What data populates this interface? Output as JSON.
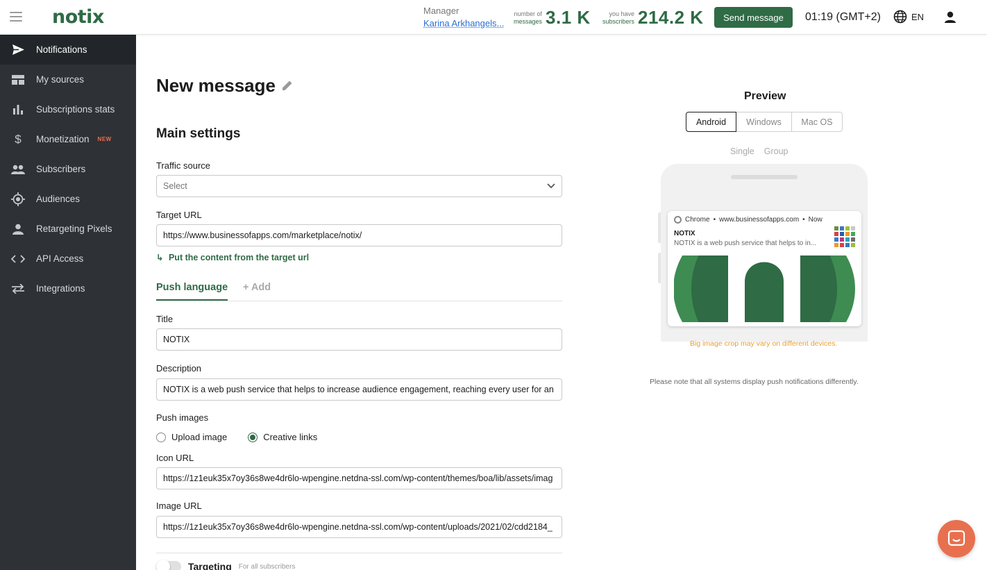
{
  "app": {
    "logo": "notix"
  },
  "header": {
    "manager_label": "Manager",
    "manager_name": "Karina Arkhangels...",
    "messages_small_1": "number of",
    "messages_small_2": "messages",
    "messages_value": "3.1 K",
    "subscribers_small_1": "you have",
    "subscribers_small_2": "subscribers",
    "subscribers_value": "214.2 K",
    "send_button": "Send message",
    "time": "01:19 (GMT+2)",
    "language": "EN"
  },
  "sidebar": {
    "items": [
      {
        "label": "Notifications",
        "icon": "send-icon",
        "active": true
      },
      {
        "label": "My sources",
        "icon": "sources-icon"
      },
      {
        "label": "Subscriptions stats",
        "icon": "bar-chart-icon"
      },
      {
        "label": "Monetization",
        "icon": "dollar-icon",
        "badge": "NEW"
      },
      {
        "label": "Subscribers",
        "icon": "people-icon"
      },
      {
        "label": "Audiences",
        "icon": "target-icon"
      },
      {
        "label": "Retargeting Pixels",
        "icon": "person-icon"
      },
      {
        "label": "API Access",
        "icon": "code-icon"
      },
      {
        "label": "Integrations",
        "icon": "swap-icon"
      }
    ]
  },
  "main": {
    "title": "New message",
    "section_title": "Main settings",
    "traffic_source": {
      "label": "Traffic source",
      "placeholder": "Select"
    },
    "target_url": {
      "label": "Target URL",
      "value": "https://www.businessofapps.com/marketplace/notix/"
    },
    "put_content_link": "Put the content from the target url",
    "tabs": {
      "active": "Push language",
      "add": "+ Add"
    },
    "title_field": {
      "label": "Title",
      "value": "NOTIX"
    },
    "description_field": {
      "label": "Description",
      "value": "NOTIX is a web push service that helps to increase audience engagement, reaching every user for an"
    },
    "push_images": {
      "label": "Push images",
      "options": [
        {
          "label": "Upload image",
          "selected": false
        },
        {
          "label": "Creative links",
          "selected": true
        }
      ]
    },
    "icon_url": {
      "label": "Icon URL",
      "value": "https://1z1euk35x7oy36s8we4dr6lo-wpengine.netdna-ssl.com/wp-content/themes/boa/lib/assets/imag"
    },
    "image_url": {
      "label": "Image URL",
      "value": "https://1z1euk35x7oy36s8we4dr6lo-wpengine.netdna-ssl.com/wp-content/uploads/2021/02/cdd2184_"
    },
    "targeting": {
      "label": "Targeting",
      "sub": "For all subscribers"
    }
  },
  "preview": {
    "title": "Preview",
    "platforms": [
      "Android",
      "Windows",
      "Mac OS"
    ],
    "active_platform": "Android",
    "modes": [
      "Single",
      "Group"
    ],
    "notification": {
      "browser": "Chrome",
      "domain": "www.businessofapps.com",
      "time": "Now",
      "title": "NOTIX",
      "description": "NOTIX is a web push service that helps to in..."
    },
    "crop_note": "Big image crop may vary on different devices.",
    "system_note": "Please note that all systems display push notifications differently."
  },
  "colors": {
    "brand_green": "#2f6b45",
    "sidebar_bg": "#2e3236",
    "accent_orange": "#e8704f",
    "warning": "#e8a033"
  }
}
